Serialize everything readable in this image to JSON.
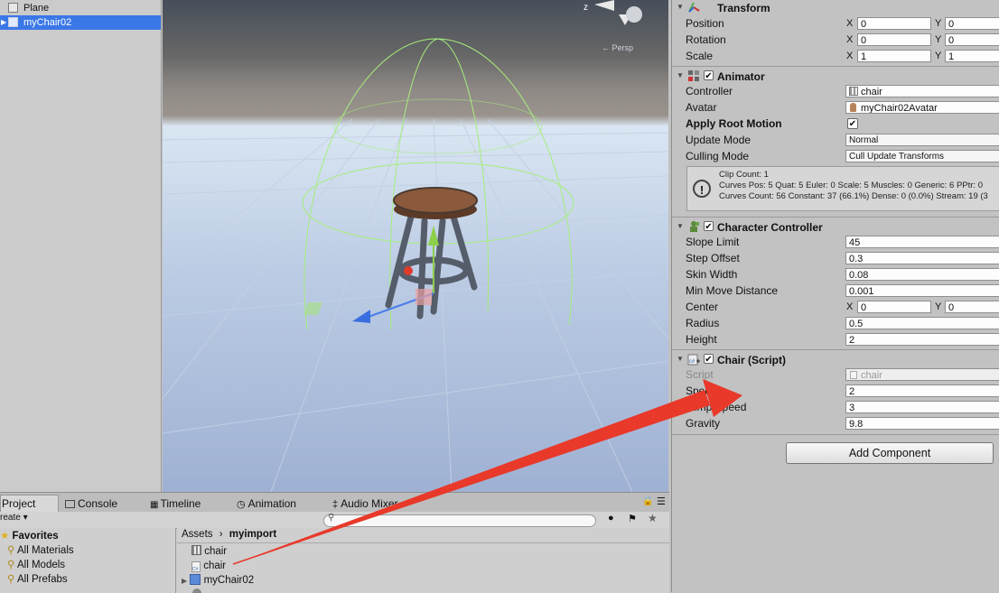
{
  "hierarchy": {
    "items": [
      {
        "label": "Plane"
      },
      {
        "label": "myChair02"
      }
    ]
  },
  "scene": {
    "gizmo_axis": "z",
    "gizmo_persp_label": "← Persp"
  },
  "inspector": {
    "transform": {
      "title": "Transform",
      "position_label": "Position",
      "rotation_label": "Rotation",
      "scale_label": "Scale",
      "x_label": "X",
      "y_label": "Y",
      "position": {
        "x": "0",
        "y": "0"
      },
      "rotation": {
        "x": "0",
        "y": "0"
      },
      "scale": {
        "x": "1",
        "y": "1"
      }
    },
    "animator": {
      "title": "Animator",
      "controller_label": "Controller",
      "controller_value": "chair",
      "avatar_label": "Avatar",
      "avatar_value": "myChair02Avatar",
      "apply_root_motion_label": "Apply Root Motion",
      "apply_root_motion_checked": "✔",
      "update_mode_label": "Update Mode",
      "update_mode_value": "Normal",
      "culling_mode_label": "Culling Mode",
      "culling_mode_value": "Cull Update Transforms",
      "info_line1": "Clip Count: 1",
      "info_line2": "Curves Pos: 5 Quat: 5 Euler: 0 Scale: 5 Muscles: 0 Generic: 6 PPtr: 0",
      "info_line3": "Curves Count: 56 Constant: 37 (66.1%) Dense: 0 (0.0%) Stream: 19 (3"
    },
    "character_controller": {
      "title": "Character Controller",
      "slope_limit_label": "Slope Limit",
      "slope_limit": "45",
      "step_offset_label": "Step Offset",
      "step_offset": "0.3",
      "skin_width_label": "Skin Width",
      "skin_width": "0.08",
      "min_move_label": "Min Move Distance",
      "min_move": "0.001",
      "center_label": "Center",
      "center": {
        "x": "0",
        "y": "0"
      },
      "radius_label": "Radius",
      "radius": "0.5",
      "height_label": "Height",
      "height": "2"
    },
    "chair_script": {
      "title": "Chair (Script)",
      "script_label": "Script",
      "script_value": "chair",
      "speed_label": "Speed",
      "speed": "2",
      "jump_speed_label": "Jump Speed",
      "jump_speed": "3",
      "gravity_label": "Gravity",
      "gravity": "9.8"
    },
    "add_component_label": "Add Component",
    "check_mark": "✔"
  },
  "bottom": {
    "tabs": [
      {
        "label": "Project"
      },
      {
        "label": "Console"
      },
      {
        "label": "Timeline"
      },
      {
        "label": "Animation"
      },
      {
        "label": "Audio Mixer"
      }
    ],
    "create_label": "reate ▾",
    "favorites": {
      "title": "Favorites",
      "items": [
        {
          "label": "All Materials"
        },
        {
          "label": "All Models"
        },
        {
          "label": "All Prefabs"
        }
      ]
    },
    "breadcrumb": {
      "root": "Assets",
      "separator": "›",
      "current": "myimport"
    },
    "assets": [
      {
        "label": "chair"
      },
      {
        "label": "chair"
      },
      {
        "label": "myChair02"
      }
    ]
  },
  "colors": {
    "selection": "#3b78e7",
    "annotation_arrow": "#e8392a",
    "collider_wire": "#9fe870"
  }
}
